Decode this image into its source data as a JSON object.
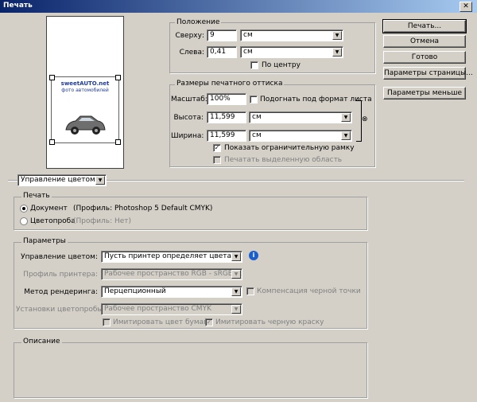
{
  "window": {
    "title": "Печать",
    "close_glyph": "✕"
  },
  "preview": {
    "logo_line1": "sweetAUTO.net",
    "logo_line2": "фото автомобилей"
  },
  "position": {
    "legend": "Положение",
    "top_label": "Сверху:",
    "top_value": "9",
    "top_unit": "см",
    "left_label": "Слева:",
    "left_value": "0,41",
    "left_unit": "см",
    "center_label": "По центру",
    "center_checked": false
  },
  "print_size": {
    "legend": "Размеры печатного оттиска",
    "scale_label": "Масштаб:",
    "scale_value": "100%",
    "fit_label": "Подогнать под формат листа",
    "fit_checked": false,
    "height_label": "Высота:",
    "height_value": "11,599",
    "height_unit": "см",
    "width_label": "Ширина:",
    "width_value": "11,599",
    "width_unit": "см",
    "bounding_label": "Показать ограничительную рамку",
    "bounding_checked": true,
    "print_selected_label": "Печатать выделенную область",
    "print_selected_checked": false
  },
  "buttons": {
    "print": "Печать...",
    "cancel": "Отмена",
    "done": "Готово",
    "page_setup": "Параметры страницы...",
    "fewer_options": "Параметры меньше"
  },
  "mode_select": {
    "value": "Управление цветом"
  },
  "print_group": {
    "legend": "Печать",
    "document_label": "Документ",
    "document_profile": "(Профиль: Photoshop 5 Default CMYK)",
    "proof_label": "Цветопроба",
    "proof_profile": "(Профиль: Нет)",
    "selected": "document"
  },
  "options_group": {
    "legend": "Параметры",
    "color_handling_label": "Управление цветом:",
    "color_handling_value": "Пусть принтер определяет цвета",
    "printer_profile_label": "Профиль принтера:",
    "printer_profile_value": "Рабочее пространство RGB - sRGB IE...",
    "rendering_label": "Метод рендеринга:",
    "rendering_value": "Перцепционный",
    "bpc_label": "Компенсация черной точки",
    "proof_setup_label": "Установки цветопробы:",
    "proof_setup_value": "Рабочее пространство CMYK",
    "simulate_paper_label": "Имитировать цвет бумаги",
    "simulate_ink_label": "Имитировать черную краску",
    "simulate_ink_checked": true
  },
  "description_group": {
    "legend": "Описание"
  },
  "glyphs": {
    "check": "✓",
    "arrow": "▼",
    "info": "i",
    "link": "⊗"
  },
  "colors": {
    "dialog_bg": "#d4d0c8",
    "title_start": "#0a246a",
    "title_end": "#a6caf0",
    "info_blue": "#1a5fd0"
  }
}
